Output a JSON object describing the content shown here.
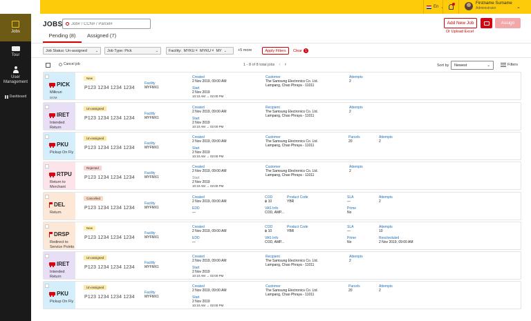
{
  "header": {
    "language": "En",
    "user_name": "Firstname Surname",
    "user_role": "Administrator"
  },
  "sidebar": {
    "items": [
      {
        "label": "Jobs",
        "icon": "box-icon",
        "active": true
      },
      {
        "label": "Tour",
        "icon": "truck-icon"
      },
      {
        "label": "User Management",
        "icon": "user-icon"
      },
      {
        "label": "Dashboard",
        "icon": "grid-icon"
      }
    ]
  },
  "page": {
    "title": "JOBS",
    "search_placeholder": "Job# / CCN# / Parcel#",
    "tabs": [
      {
        "label": "Pending (8)",
        "active": true
      },
      {
        "label": "Assigned (7)",
        "active": false
      }
    ],
    "add_new_job": "Add New Job",
    "assign": "Assign",
    "upload_excel": "Or Upload Excel"
  },
  "filters": {
    "job_status_label": "Job Status: Un-assigned",
    "job_type_label": "Job Type: Pick",
    "facility_label": "Facility:",
    "facility_chips": [
      "MYKU",
      "MYKU",
      "MY"
    ],
    "more": "+5 more",
    "apply": "Apply Filters",
    "clear": "Clear",
    "clear_count": "1"
  },
  "list": {
    "cancel_job": "Cancel job",
    "pagination": "1 - 8 of 8 total jobs",
    "sort_by_label": "Sort by",
    "sort_value": "Newest",
    "filters_label": "Filters"
  },
  "jobs": [
    {
      "type": "PICK",
      "icon": "truck",
      "sub1": "Milkrun",
      "sub2": "DOM",
      "status": "New",
      "status_color": "#fdf0b0",
      "stripe": "#d4eefc",
      "id": "P123 1234 1234 1234",
      "facility_label": "Facility",
      "facility": "MYFMX1",
      "created_label": "Created",
      "created": "2 Nov 2019, 09:00 AM",
      "start_label": "Start",
      "start_date": "2 Nov 2019",
      "start_time": "10:10 AM → 02:00 PM",
      "party_label": "Customer",
      "party_name": "The Samsung Electronics Co. Ltd.",
      "party_addr": "Lampang, Chao Phraya - 11011",
      "parcels_label": "",
      "parcels": "",
      "attempts_label": "Attempts",
      "attempts": "2"
    },
    {
      "type": "IRET",
      "icon": "truck",
      "sub1": "Intended",
      "sub2": "Return",
      "status": "Un-assigned",
      "status_color": "#fbe7a6",
      "stripe": "#e8def6",
      "id": "P123 1234 1234 1234",
      "facility_label": "Facility",
      "facility": "MYFMX1",
      "created_label": "Created",
      "created": "2 Nov 2019, 09:00 AM",
      "start_label": "Start",
      "start_date": "2 Nov 2019",
      "start_time": "10:10 AM → 02:00 PM",
      "party_label": "Recipient",
      "party_name": "The Samsung Electronics Co. Ltd.",
      "party_addr": "Lampang, Chao Phraya - 11011",
      "parcels_label": "",
      "parcels": "",
      "attempts_label": "Attempts",
      "attempts": "2"
    },
    {
      "type": "PKU",
      "icon": "truck",
      "sub1": "Pickup On Fly",
      "sub2": "",
      "status": "Un-assigned",
      "status_color": "#fbe7a6",
      "stripe": "#d4eefc",
      "id": "P123 1234 1234 1234",
      "facility_label": "Facility",
      "facility": "MYFMX1",
      "created_label": "Created",
      "created": "2 Nov 2019, 09:00 AM",
      "start_label": "Start",
      "start_date": "2 Nov 2019",
      "start_time": "10:10 AM → 02:00 PM",
      "party_label": "Customer",
      "party_name": "The Samsung Electronics Co. Ltd.",
      "party_addr": "Lampang, Chao Phraya - 11011",
      "parcels_label": "Parcels",
      "parcels": "20",
      "attempts_label": "Attempts",
      "attempts": "2"
    },
    {
      "type": "RTPU",
      "icon": "truck",
      "sub1": "Return to",
      "sub2": "Merchant",
      "status": "Rejected",
      "status_color": "#f8d3d3",
      "stripe": "#fde3ea",
      "id": "P123 1234 1234 1234",
      "facility_label": "Facility",
      "facility": "MYFMX1",
      "created_label": "Created",
      "created": "2 Nov 2019, 09:00 AM",
      "start_label": "Start",
      "start_date": "2 Nov 2019",
      "start_time": "10:10 AM → 02:00 PM",
      "party_label": "Customer",
      "party_name": "The Samsung Electronics Co. Ltd.",
      "party_addr": "Lampang, Chao Phraya - 11011",
      "parcels_label": "",
      "parcels": "",
      "attempts_label": "Attempts",
      "attempts": "2"
    },
    {
      "type": "DEL",
      "icon": "flag",
      "sub1": "Return",
      "sub2": "",
      "status": "Cancelled",
      "status_color": "#f9d9c4",
      "stripe": "#fde8d8",
      "id": "P123 1234 1234 1234",
      "facility_label": "Facility",
      "facility": "MYFMX1",
      "created_label": "Created",
      "created": "2 Nov 2019, 09:00 AM",
      "edd_label": "EDD",
      "edd": "—",
      "cod_label": "COD",
      "cod": "฿ 10",
      "product_label": "Product Code",
      "product": "YBR",
      "vas_label": "VAS Info",
      "vas": "COD, AMP...",
      "sla_label": "SLA",
      "sla": "—",
      "prime_label": "Prime",
      "prime": "No",
      "attempts_label": "Attempts",
      "attempts": "2"
    },
    {
      "type": "DRSP",
      "icon": "flag",
      "sub1": "Redirect to",
      "sub2": "Service Points",
      "status": "New",
      "status_color": "#fdf0b0",
      "stripe": "#fde8d8",
      "id": "P123 1234 1234 1234",
      "facility_label": "Facility",
      "facility": "MYFMX1",
      "created_label": "Created",
      "created": "2 Nov 2019, 09:00 AM",
      "edd_label": "EDD",
      "edd": "—",
      "cod_label": "COD",
      "cod": "฿ 10",
      "product_label": "Product Code",
      "product": "YBR",
      "vas_label": "VAS Info",
      "vas": "COD, AMP...",
      "sla_label": "SLA",
      "sla": "—",
      "prime_label": "Prime",
      "prime": "No",
      "attempts_label": "Attempts",
      "attempts": "10",
      "resched_label": "Rescheduled",
      "resched": "2 Nov 2019, 09:00 AM"
    },
    {
      "type": "IRET",
      "icon": "truck",
      "sub1": "Intended",
      "sub2": "Return",
      "status": "Un-assigned",
      "status_color": "#fbe7a6",
      "stripe": "#e8def6",
      "id": "P123 1234 1234 1234",
      "facility_label": "Facility",
      "facility": "MYFMX1",
      "created_label": "Created",
      "created": "2 Nov 2019, 09:00 AM",
      "start_label": "Start",
      "start_date": "2 Nov 2019",
      "start_time": "10:10 AM → 02:00 PM",
      "party_label": "Recipient",
      "party_name": "The Samsung Electronics Co. Ltd.",
      "party_addr": "Lampang, Chao Phraya - 11011",
      "parcels_label": "",
      "parcels": "",
      "attempts_label": "Attempts",
      "attempts": "2"
    },
    {
      "type": "PKU",
      "icon": "truck",
      "sub1": "Pickup On Fly",
      "sub2": "",
      "status": "Un-assigned",
      "status_color": "#fbe7a6",
      "stripe": "#d4eefc",
      "id": "P123 1234 1234 1234",
      "facility_label": "Facility",
      "facility": "MYFMX1",
      "created_label": "Created",
      "created": "2 Nov 2019, 09:00 AM",
      "start_label": "Start",
      "start_date": "2 Nov 2019",
      "start_time": "10:10 AM → 02:00 PM",
      "party_label": "Customer",
      "party_name": "The Samsung Electronics Co. Ltd.",
      "party_addr": "Lampang, Chao Phraya - 11011",
      "parcels_label": "Parcels",
      "parcels": "20",
      "attempts_label": "Attempts",
      "attempts": "2"
    }
  ]
}
